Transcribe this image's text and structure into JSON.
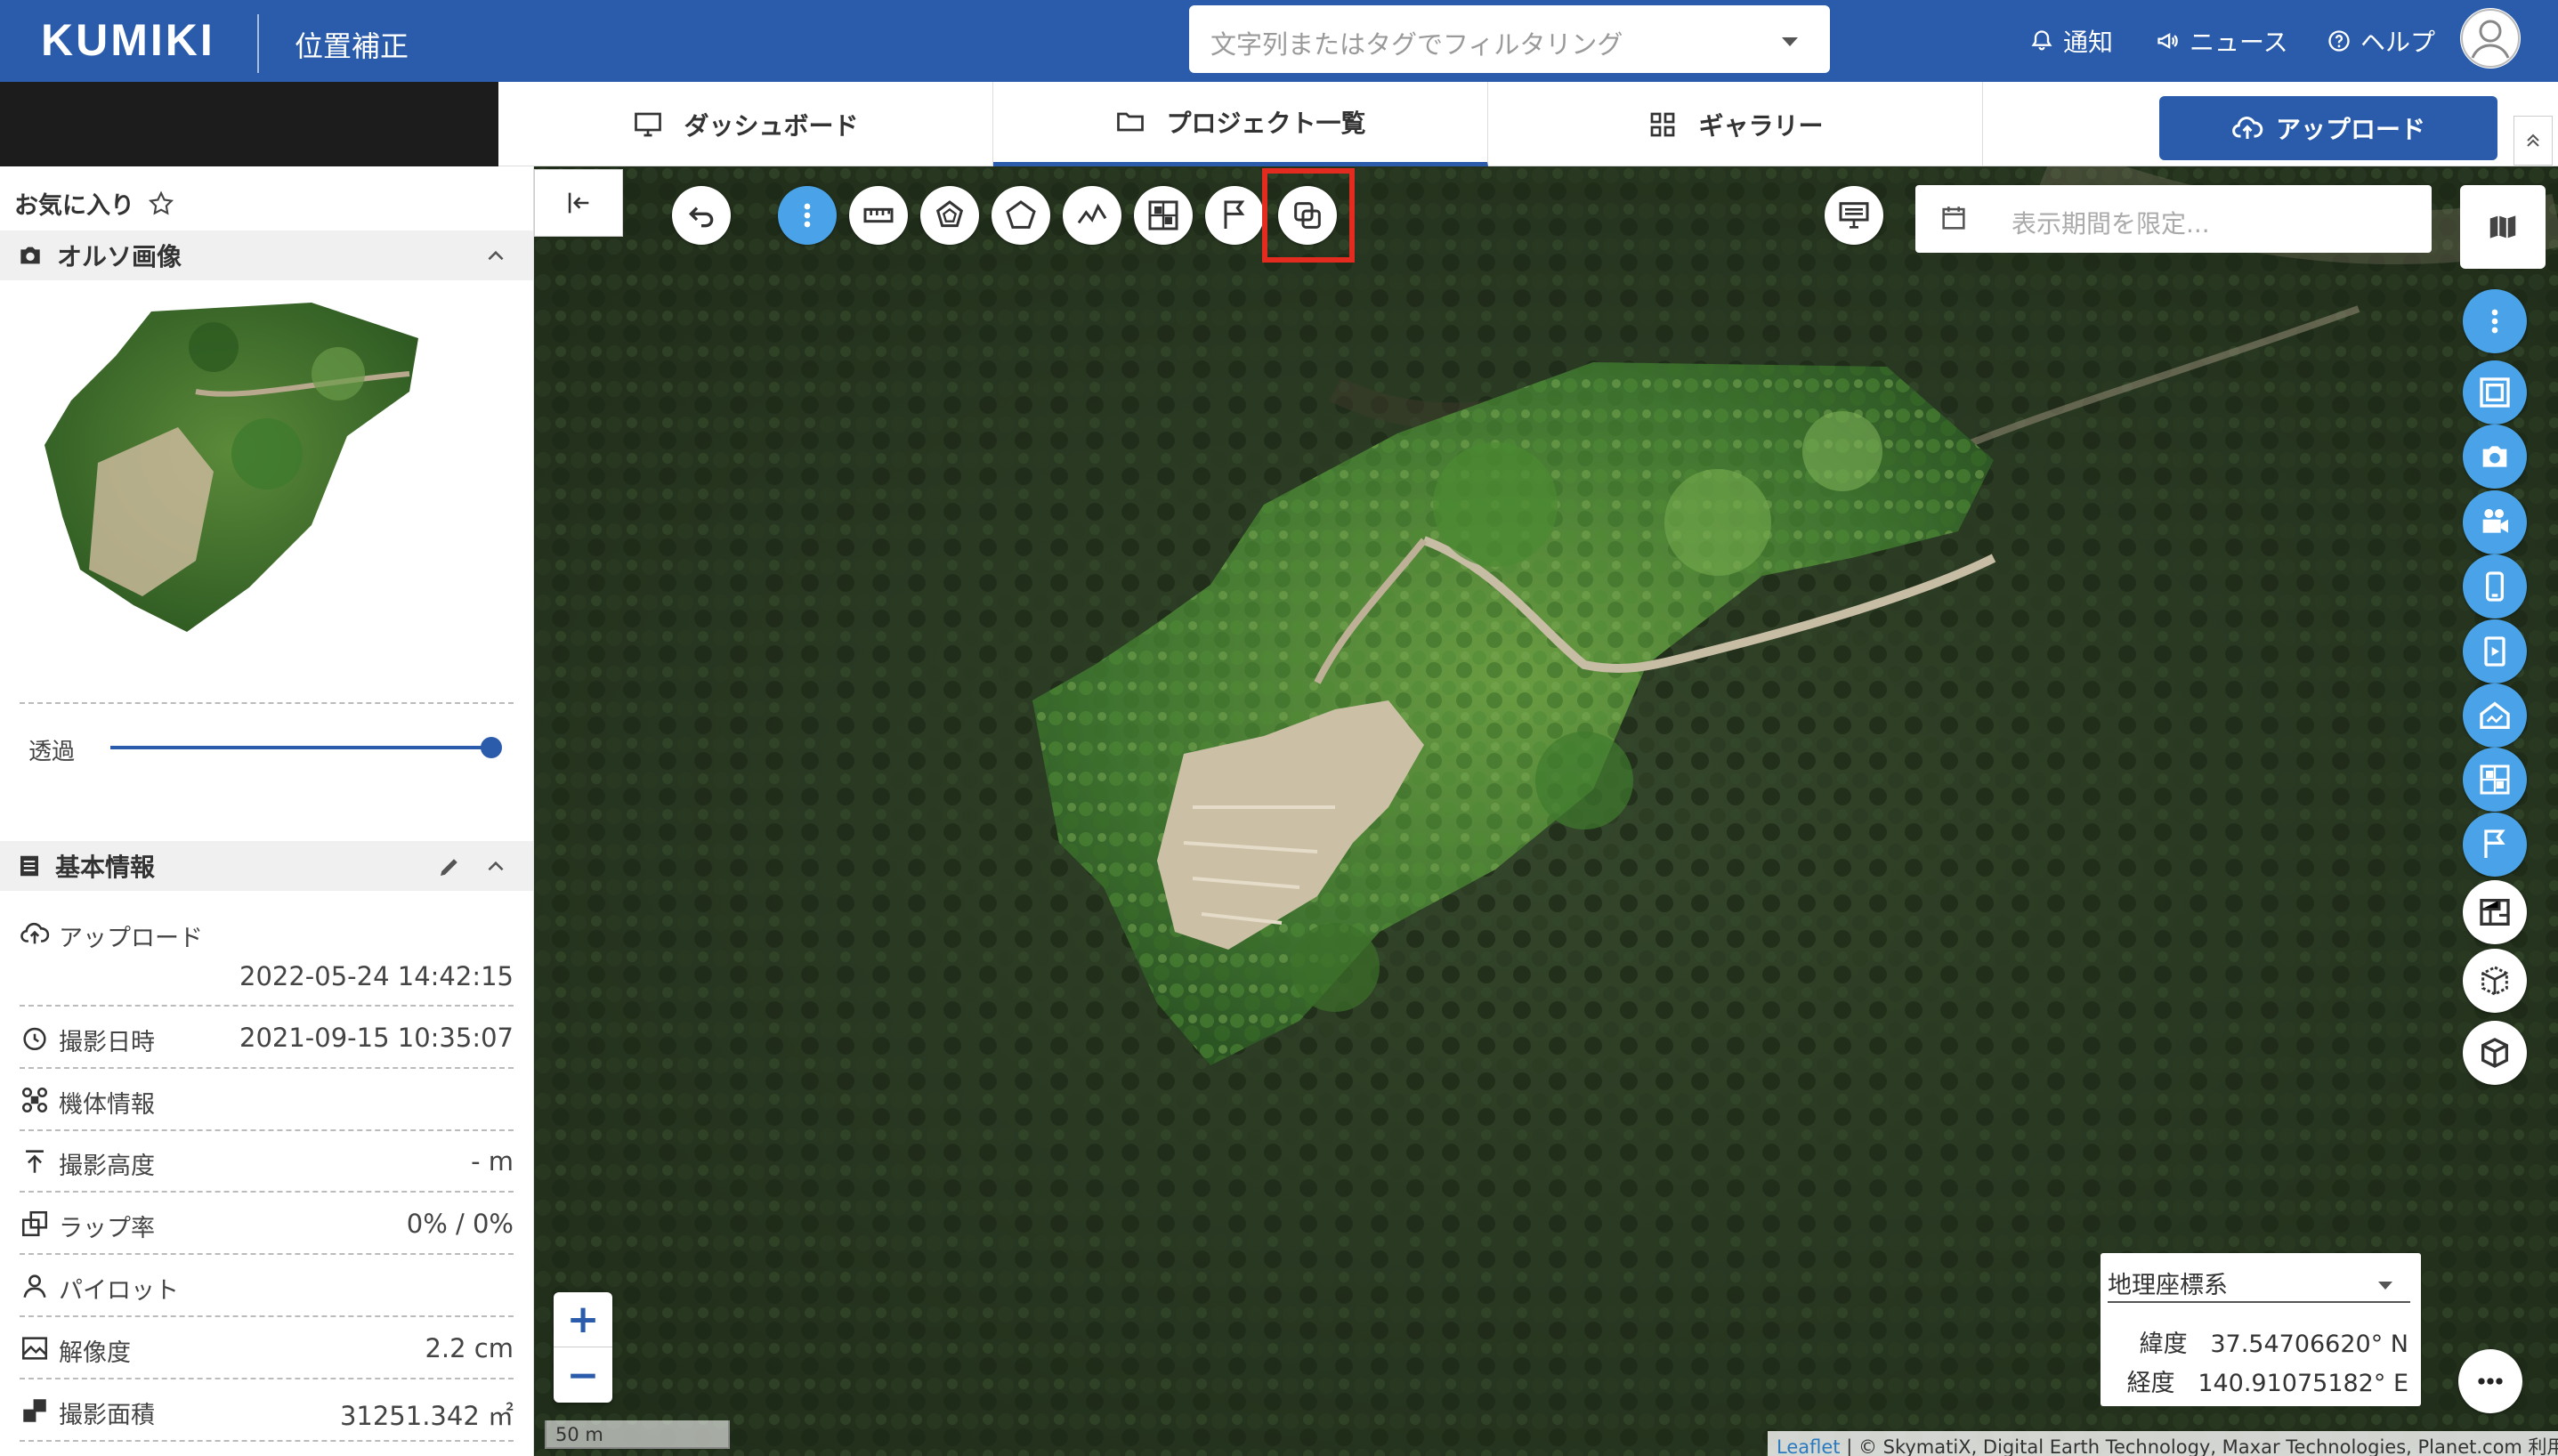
{
  "header": {
    "logo": "KUMIKI",
    "subtitle": "位置補正",
    "filter_placeholder": "文字列またはタグでフィルタリング",
    "notifications": "通知",
    "news": "ニュース",
    "help": "ヘルプ"
  },
  "nav": {
    "tabs": [
      {
        "label": "ダッシュボード",
        "icon": "monitor-icon"
      },
      {
        "label": "プロジェクト一覧",
        "icon": "folder-icon",
        "active": true
      },
      {
        "label": "ギャラリー",
        "icon": "grid-icon"
      }
    ],
    "upload_label": "アップロード"
  },
  "sidebar": {
    "favorite_label": "お気に入り",
    "ortho": {
      "title": "オルソ画像",
      "opacity_label": "透過",
      "opacity_value": 1.0
    },
    "basic_info": {
      "title": "基本情報",
      "rows": [
        {
          "label": "アップロード",
          "value": "2022-05-24 14:42:15",
          "icon": "upload-icon"
        },
        {
          "label": "撮影日時",
          "value": "2021-09-15 10:35:07",
          "icon": "clock-icon"
        },
        {
          "label": "機体情報",
          "value": "",
          "icon": "drone-icon"
        },
        {
          "label": "撮影高度",
          "value": "- m",
          "icon": "altitude-icon"
        },
        {
          "label": "ラップ率",
          "value": "0% / 0%",
          "icon": "overlap-icon"
        },
        {
          "label": "パイロット",
          "value": "",
          "icon": "person-icon"
        },
        {
          "label": "解像度",
          "value": "2.2 cm",
          "icon": "image-icon"
        },
        {
          "label": "撮影面積",
          "value": "31251.342 ㎡",
          "icon": "area-icon"
        }
      ]
    }
  },
  "map": {
    "date_placeholder": "表示期間を限定...",
    "scale_label": "50 m",
    "coord_system": "地理座標系",
    "latitude_label": "緯度",
    "latitude_value": "37.54706620° N",
    "longitude_label": "経度",
    "longitude_value": "140.91075182° E",
    "attribution_leaflet": "Leaflet",
    "attribution_text": " | © SkymatiX, Digital Earth Technology, Maxar Technologies, Planet.com 利用規約",
    "zoom_in": "+",
    "zoom_out": "−"
  },
  "colors": {
    "brand": "#2a5cab",
    "accent": "#4aa3e8",
    "highlight": "#e32b1f"
  }
}
